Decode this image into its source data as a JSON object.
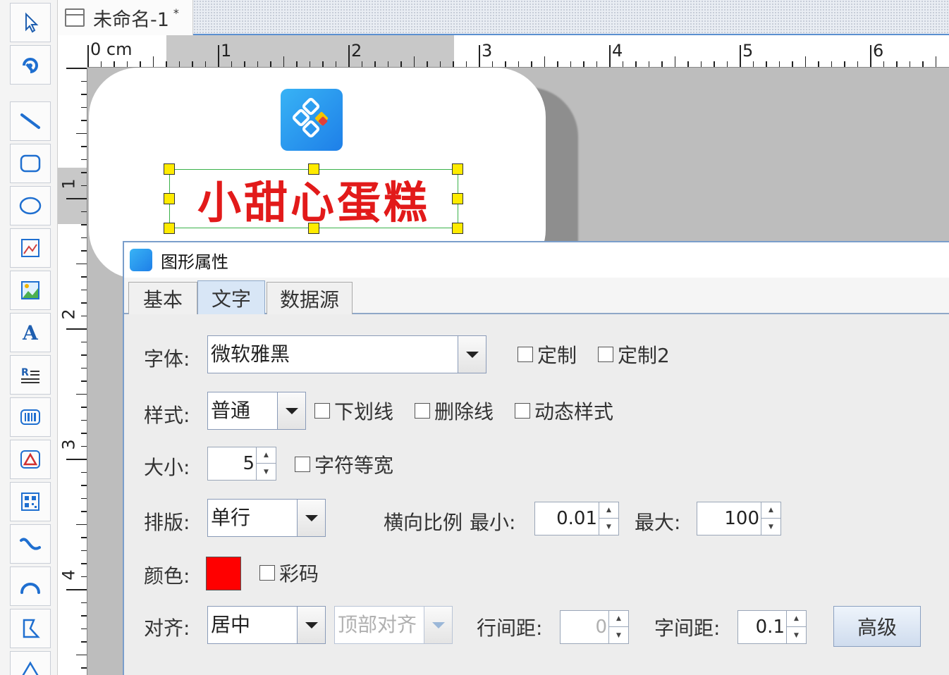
{
  "document": {
    "title": "未命名-1",
    "dirty_mark": "*"
  },
  "ruler": {
    "unit_label": "0 cm",
    "h_numbers": [
      "1",
      "2",
      "3",
      "4",
      "5",
      "6"
    ],
    "v_numbers": [
      "1",
      "2",
      "3",
      "4"
    ]
  },
  "toolbox": {
    "tools": [
      "select-pointer-icon",
      "rotate-icon",
      "line-icon",
      "rounded-rect-icon",
      "ellipse-icon",
      "picture-frame-icon",
      "image-icon",
      "text-icon",
      "rich-text-icon",
      "barcode-icon",
      "shape-icon",
      "qrcode-icon",
      "curve-icon",
      "arc-icon",
      "polygon-icon",
      "triangle-icon"
    ]
  },
  "canvas": {
    "text_object": "小甜心蛋糕",
    "text_color": "#e21a1a"
  },
  "dialog": {
    "title": "图形属性",
    "tabs": [
      "基本",
      "文字",
      "数据源"
    ],
    "active_tab": "文字",
    "font": {
      "label": "字体:",
      "value": "微软雅黑",
      "custom_label": "定制",
      "custom2_label": "定制2"
    },
    "style": {
      "label": "样式:",
      "value": "普通",
      "underline_label": "下划线",
      "strikethrough_label": "删除线",
      "dynamic_label": "动态样式"
    },
    "size": {
      "label": "大小:",
      "value": "5",
      "monospace_label": "字符等宽"
    },
    "layout": {
      "label": "排版:",
      "value": "单行",
      "hscale_label": "横向比例",
      "min_label": "最小:",
      "min_value": "0.01",
      "max_label": "最大:",
      "max_value": "100"
    },
    "color": {
      "label": "颜色:",
      "value": "#ff0000",
      "colorcode_label": "彩码"
    },
    "align": {
      "label": "对齐:",
      "value": "居中",
      "vertical_value": "顶部对齐",
      "line_spacing_label": "行间距:",
      "line_spacing_value": "0",
      "char_spacing_label": "字间距:",
      "char_spacing_value": "0.1",
      "advanced_label": "高级"
    }
  }
}
